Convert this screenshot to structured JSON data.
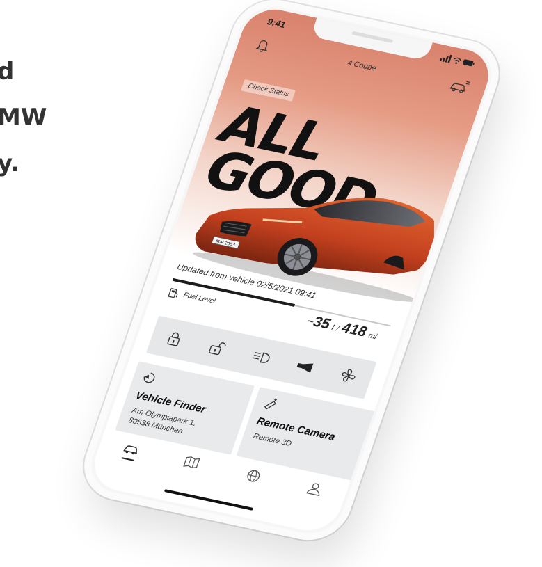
{
  "background": {
    "headline_lines": [
      "d",
      "MW",
      "y."
    ]
  },
  "status_bar": {
    "time": "9:41",
    "icons": "signal wifi battery"
  },
  "top_bar": {
    "title": "4 Coupe",
    "left_icon": "bell-icon",
    "right_icon": "car-settings-icon"
  },
  "hero": {
    "check_status_label": "Check Status",
    "headline_line1": "ALL",
    "headline_line2": "GOOD",
    "accent_color": "#d9826d",
    "car_color": "#c4411f",
    "plate_text": "M-P 2053"
  },
  "vehicle": {
    "updated_text": "Updated from vehicle 02/5/2021 09:41",
    "fuel_label": "Fuel Level",
    "fuel_fraction": 0.56,
    "range_prefix": "~",
    "fuel_liters": "35",
    "fuel_unit": "l",
    "separator": "/",
    "range_miles": "418",
    "range_unit": "mi"
  },
  "actions": [
    {
      "name": "lock-icon"
    },
    {
      "name": "unlock-icon"
    },
    {
      "name": "headlight-icon"
    },
    {
      "name": "horn-icon"
    },
    {
      "name": "fan-icon"
    }
  ],
  "cards": {
    "finder": {
      "icon": "locate-icon",
      "title": "Vehicle Finder",
      "address": "Am Olympiapark 1,\n80538 München"
    },
    "camera": {
      "icon": "drone-camera-icon",
      "title": "Remote Camera",
      "subtitle": "Remote 3D"
    }
  },
  "tabs": [
    {
      "name": "tab-vehicle",
      "icon": "car-icon",
      "active": true
    },
    {
      "name": "tab-map",
      "icon": "map-icon",
      "active": false
    },
    {
      "name": "tab-explore",
      "icon": "globe-icon",
      "active": false
    },
    {
      "name": "tab-profile",
      "icon": "profile-icon",
      "active": false
    }
  ]
}
